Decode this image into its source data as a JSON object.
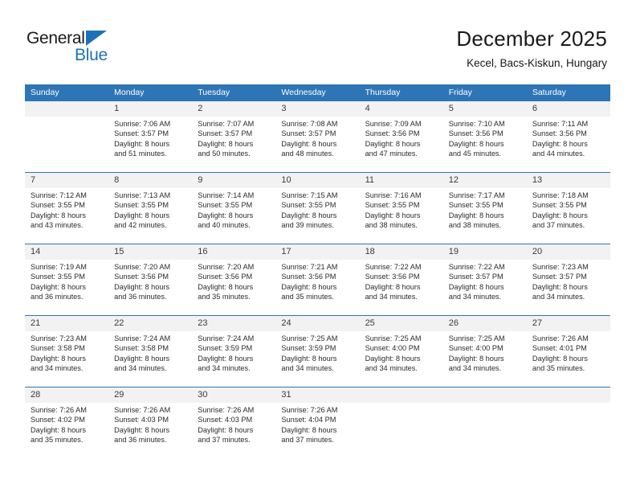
{
  "brand": {
    "name_top": "General",
    "name_bottom": "Blue",
    "accent_color": "#1c72b8"
  },
  "header": {
    "title": "December 2025",
    "subtitle": "Kecel, Bacs-Kiskun, Hungary"
  },
  "theme": {
    "header_bar_color": "#2e75b6",
    "day_number_bg": "#f2f2f2",
    "text_color": "#2b2b2b"
  },
  "weekdays": [
    "Sunday",
    "Monday",
    "Tuesday",
    "Wednesday",
    "Thursday",
    "Friday",
    "Saturday"
  ],
  "weeks": [
    [
      {
        "day": "",
        "lines": []
      },
      {
        "day": "1",
        "lines": [
          "Sunrise: 7:06 AM",
          "Sunset: 3:57 PM",
          "Daylight: 8 hours",
          "and 51 minutes."
        ]
      },
      {
        "day": "2",
        "lines": [
          "Sunrise: 7:07 AM",
          "Sunset: 3:57 PM",
          "Daylight: 8 hours",
          "and 50 minutes."
        ]
      },
      {
        "day": "3",
        "lines": [
          "Sunrise: 7:08 AM",
          "Sunset: 3:57 PM",
          "Daylight: 8 hours",
          "and 48 minutes."
        ]
      },
      {
        "day": "4",
        "lines": [
          "Sunrise: 7:09 AM",
          "Sunset: 3:56 PM",
          "Daylight: 8 hours",
          "and 47 minutes."
        ]
      },
      {
        "day": "5",
        "lines": [
          "Sunrise: 7:10 AM",
          "Sunset: 3:56 PM",
          "Daylight: 8 hours",
          "and 45 minutes."
        ]
      },
      {
        "day": "6",
        "lines": [
          "Sunrise: 7:11 AM",
          "Sunset: 3:56 PM",
          "Daylight: 8 hours",
          "and 44 minutes."
        ]
      }
    ],
    [
      {
        "day": "7",
        "lines": [
          "Sunrise: 7:12 AM",
          "Sunset: 3:55 PM",
          "Daylight: 8 hours",
          "and 43 minutes."
        ]
      },
      {
        "day": "8",
        "lines": [
          "Sunrise: 7:13 AM",
          "Sunset: 3:55 PM",
          "Daylight: 8 hours",
          "and 42 minutes."
        ]
      },
      {
        "day": "9",
        "lines": [
          "Sunrise: 7:14 AM",
          "Sunset: 3:55 PM",
          "Daylight: 8 hours",
          "and 40 minutes."
        ]
      },
      {
        "day": "10",
        "lines": [
          "Sunrise: 7:15 AM",
          "Sunset: 3:55 PM",
          "Daylight: 8 hours",
          "and 39 minutes."
        ]
      },
      {
        "day": "11",
        "lines": [
          "Sunrise: 7:16 AM",
          "Sunset: 3:55 PM",
          "Daylight: 8 hours",
          "and 38 minutes."
        ]
      },
      {
        "day": "12",
        "lines": [
          "Sunrise: 7:17 AM",
          "Sunset: 3:55 PM",
          "Daylight: 8 hours",
          "and 38 minutes."
        ]
      },
      {
        "day": "13",
        "lines": [
          "Sunrise: 7:18 AM",
          "Sunset: 3:55 PM",
          "Daylight: 8 hours",
          "and 37 minutes."
        ]
      }
    ],
    [
      {
        "day": "14",
        "lines": [
          "Sunrise: 7:19 AM",
          "Sunset: 3:55 PM",
          "Daylight: 8 hours",
          "and 36 minutes."
        ]
      },
      {
        "day": "15",
        "lines": [
          "Sunrise: 7:20 AM",
          "Sunset: 3:56 PM",
          "Daylight: 8 hours",
          "and 36 minutes."
        ]
      },
      {
        "day": "16",
        "lines": [
          "Sunrise: 7:20 AM",
          "Sunset: 3:56 PM",
          "Daylight: 8 hours",
          "and 35 minutes."
        ]
      },
      {
        "day": "17",
        "lines": [
          "Sunrise: 7:21 AM",
          "Sunset: 3:56 PM",
          "Daylight: 8 hours",
          "and 35 minutes."
        ]
      },
      {
        "day": "18",
        "lines": [
          "Sunrise: 7:22 AM",
          "Sunset: 3:56 PM",
          "Daylight: 8 hours",
          "and 34 minutes."
        ]
      },
      {
        "day": "19",
        "lines": [
          "Sunrise: 7:22 AM",
          "Sunset: 3:57 PM",
          "Daylight: 8 hours",
          "and 34 minutes."
        ]
      },
      {
        "day": "20",
        "lines": [
          "Sunrise: 7:23 AM",
          "Sunset: 3:57 PM",
          "Daylight: 8 hours",
          "and 34 minutes."
        ]
      }
    ],
    [
      {
        "day": "21",
        "lines": [
          "Sunrise: 7:23 AM",
          "Sunset: 3:58 PM",
          "Daylight: 8 hours",
          "and 34 minutes."
        ]
      },
      {
        "day": "22",
        "lines": [
          "Sunrise: 7:24 AM",
          "Sunset: 3:58 PM",
          "Daylight: 8 hours",
          "and 34 minutes."
        ]
      },
      {
        "day": "23",
        "lines": [
          "Sunrise: 7:24 AM",
          "Sunset: 3:59 PM",
          "Daylight: 8 hours",
          "and 34 minutes."
        ]
      },
      {
        "day": "24",
        "lines": [
          "Sunrise: 7:25 AM",
          "Sunset: 3:59 PM",
          "Daylight: 8 hours",
          "and 34 minutes."
        ]
      },
      {
        "day": "25",
        "lines": [
          "Sunrise: 7:25 AM",
          "Sunset: 4:00 PM",
          "Daylight: 8 hours",
          "and 34 minutes."
        ]
      },
      {
        "day": "26",
        "lines": [
          "Sunrise: 7:25 AM",
          "Sunset: 4:00 PM",
          "Daylight: 8 hours",
          "and 34 minutes."
        ]
      },
      {
        "day": "27",
        "lines": [
          "Sunrise: 7:26 AM",
          "Sunset: 4:01 PM",
          "Daylight: 8 hours",
          "and 35 minutes."
        ]
      }
    ],
    [
      {
        "day": "28",
        "lines": [
          "Sunrise: 7:26 AM",
          "Sunset: 4:02 PM",
          "Daylight: 8 hours",
          "and 35 minutes."
        ]
      },
      {
        "day": "29",
        "lines": [
          "Sunrise: 7:26 AM",
          "Sunset: 4:03 PM",
          "Daylight: 8 hours",
          "and 36 minutes."
        ]
      },
      {
        "day": "30",
        "lines": [
          "Sunrise: 7:26 AM",
          "Sunset: 4:03 PM",
          "Daylight: 8 hours",
          "and 37 minutes."
        ]
      },
      {
        "day": "31",
        "lines": [
          "Sunrise: 7:26 AM",
          "Sunset: 4:04 PM",
          "Daylight: 8 hours",
          "and 37 minutes."
        ]
      },
      {
        "day": "",
        "lines": []
      },
      {
        "day": "",
        "lines": []
      },
      {
        "day": "",
        "lines": []
      }
    ]
  ]
}
